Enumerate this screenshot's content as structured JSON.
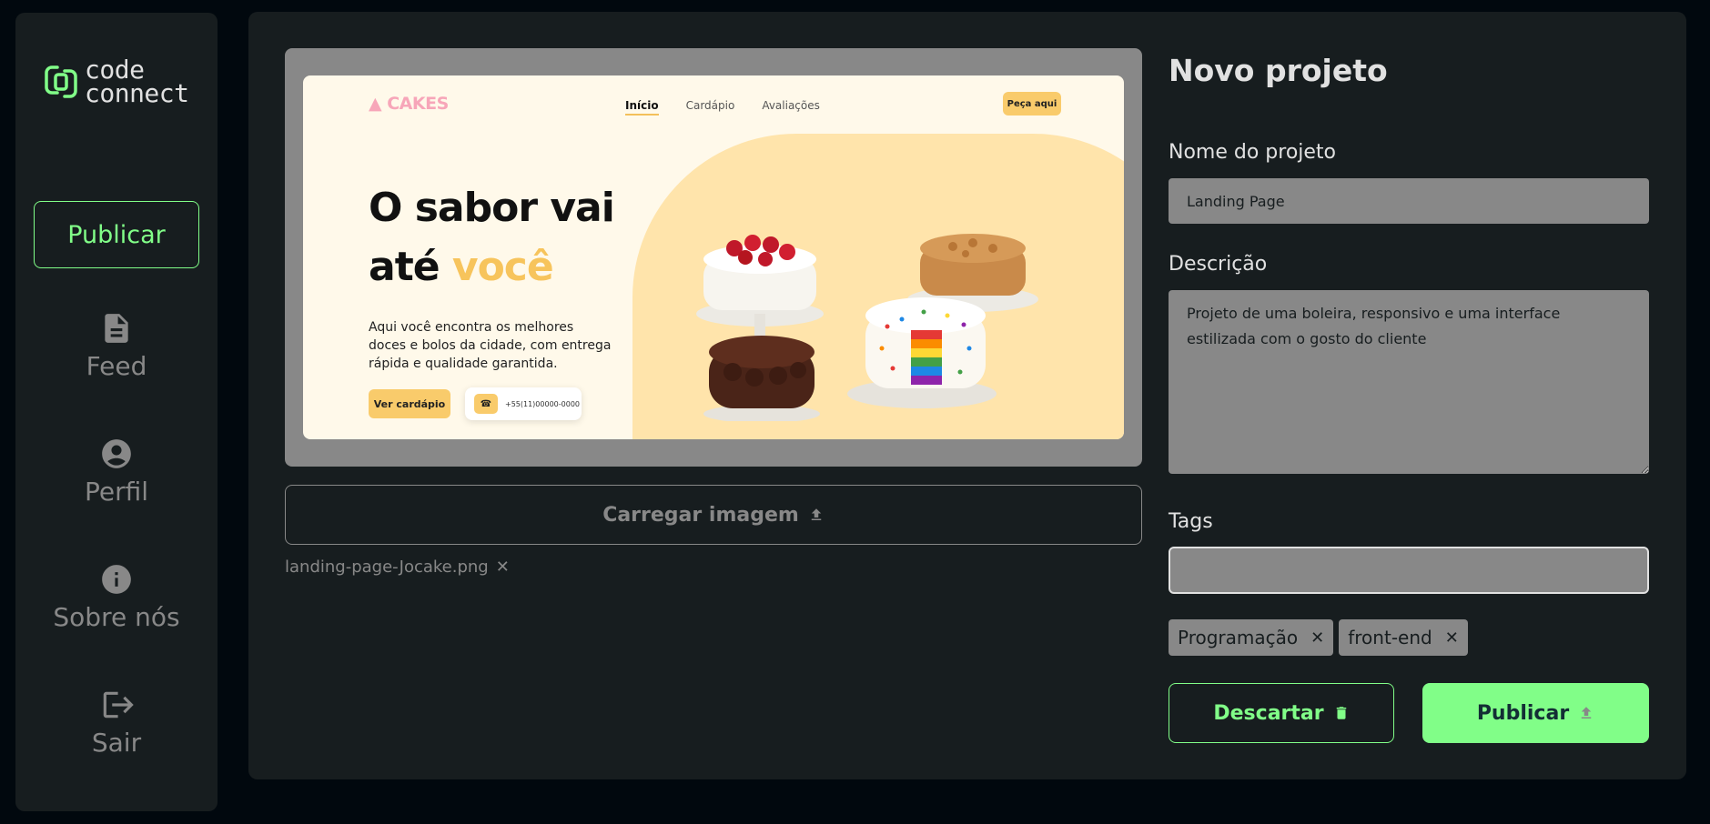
{
  "brand": {
    "line1": "code",
    "line2": "connect"
  },
  "sidebar": {
    "publish_label": "Publicar",
    "items": [
      {
        "label": "Feed",
        "icon": "document-icon"
      },
      {
        "label": "Perfil",
        "icon": "account-icon"
      },
      {
        "label": "Sobre nós",
        "icon": "info-icon"
      },
      {
        "label": "Sair",
        "icon": "logout-icon"
      }
    ]
  },
  "preview": {
    "site_logo": "CAKES",
    "nav": [
      "Início",
      "Cardápio",
      "Avaliações"
    ],
    "order_button": "Peça aqui",
    "hero_line1": "O sabor vai",
    "hero_line2_prefix": "até ",
    "hero_line2_highlight": "você",
    "description": "Aqui você encontra os melhores doces e bolos da cidade, com entrega rápida e qualidade garantida.",
    "menu_button": "Ver cardápio",
    "phone": "+55(11)00000-0000"
  },
  "upload": {
    "button_label": "Carregar imagem",
    "file_name": "landing-page-Jocake.png"
  },
  "form": {
    "title": "Novo projeto",
    "name_label": "Nome do projeto",
    "name_value": "Landing Page",
    "description_label": "Descrição",
    "description_value": "Projeto de uma boleira, responsivo e uma interface estilizada com o gosto do cliente",
    "tags_label": "Tags",
    "tags_value": "",
    "tags": [
      "Programação",
      "front-end"
    ],
    "discard_label": "Descartar",
    "publish_label": "Publicar"
  },
  "colors": {
    "accent": "#81fe88",
    "background": "#01080e",
    "surface": "#171d1f",
    "muted": "#888888",
    "text": "#e1e1e1"
  }
}
